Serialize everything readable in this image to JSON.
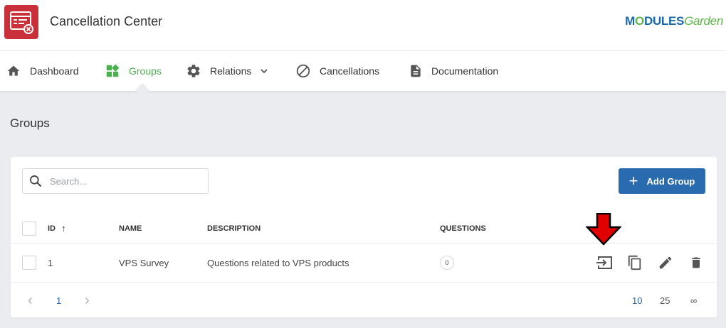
{
  "header": {
    "app_title": "Cancellation Center",
    "brand": {
      "part1": "M",
      "part2": "O",
      "part3": "DULES",
      "part4": "Garden"
    }
  },
  "nav": {
    "items": [
      {
        "label": "Dashboard",
        "icon": "home-icon"
      },
      {
        "label": "Groups",
        "icon": "groups-icon",
        "active": true
      },
      {
        "label": "Relations",
        "icon": "gear-icon",
        "has_dropdown": true
      },
      {
        "label": "Cancellations",
        "icon": "block-icon"
      },
      {
        "label": "Documentation",
        "icon": "document-icon"
      }
    ]
  },
  "page": {
    "title": "Groups"
  },
  "toolbar": {
    "search_placeholder": "Search...",
    "add_label": "Add Group"
  },
  "table": {
    "columns": [
      "ID",
      "NAME",
      "DESCRIPTION",
      "QUESTIONS"
    ],
    "sort_indicator": "↑",
    "rows": [
      {
        "id": "1",
        "name": "VPS Survey",
        "description": "Questions related to VPS products",
        "questions": "0"
      }
    ]
  },
  "pagination": {
    "prev": "‹",
    "current": "1",
    "next": "›",
    "sizes": [
      "10",
      "25",
      "∞"
    ],
    "selected_size": "10"
  },
  "colors": {
    "accent_blue": "#2a6bb0",
    "accent_green": "#4caf50",
    "logo_red": "#c9303a",
    "annotation_red": "#e00000"
  }
}
